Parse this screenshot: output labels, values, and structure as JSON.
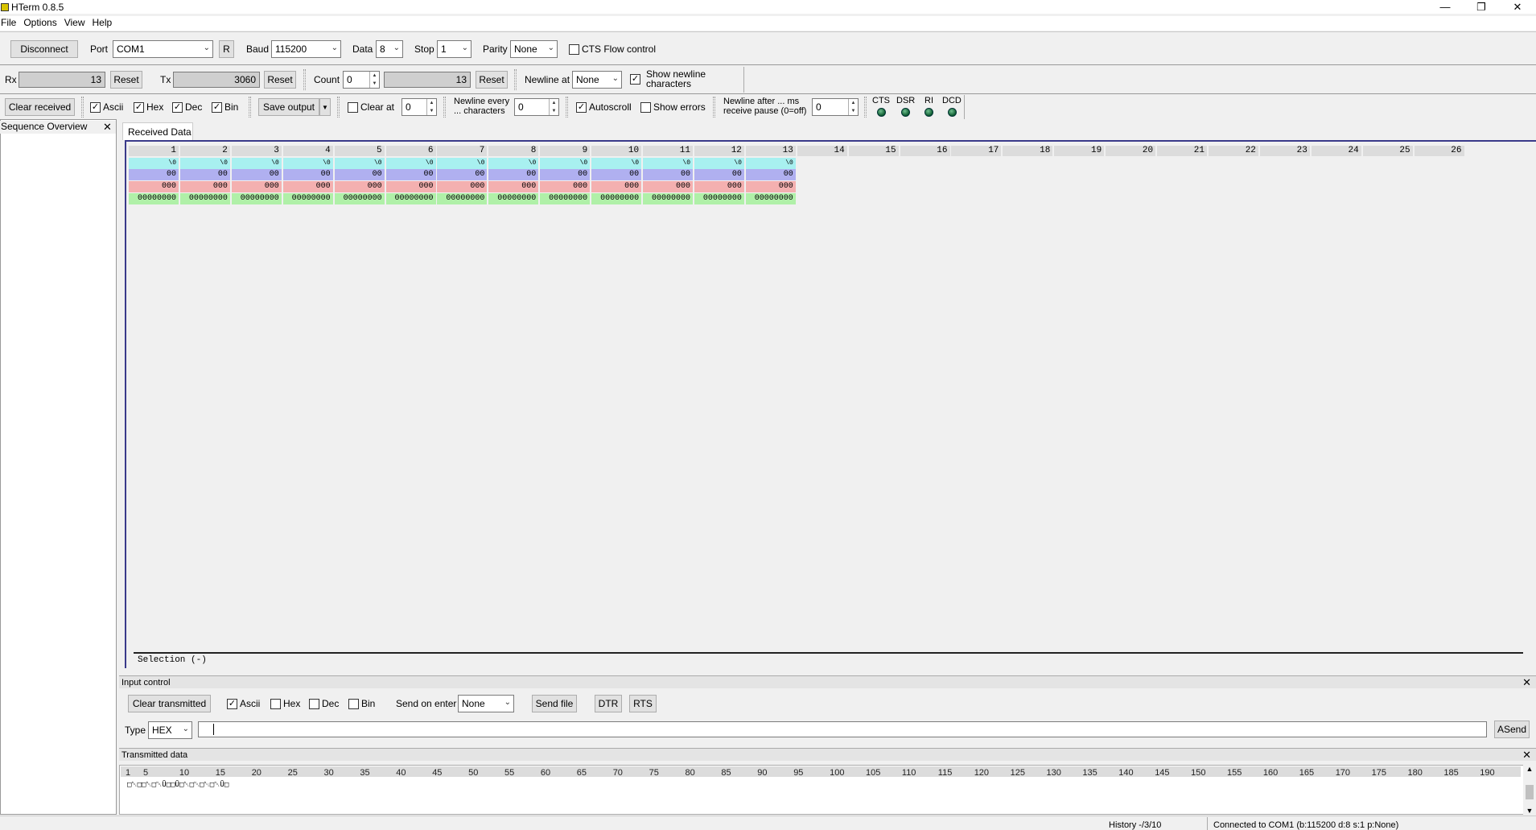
{
  "window": {
    "title": "HTerm 0.8.5",
    "minimize": "—",
    "restore": "❐",
    "close": "✕"
  },
  "menu": [
    "File",
    "Options",
    "View",
    "Help"
  ],
  "conn": {
    "disconnect": "Disconnect",
    "port_label": "Port",
    "port": "COM1",
    "r_button": "R",
    "baud_label": "Baud",
    "baud": "115200",
    "data_label": "Data",
    "data": "8",
    "stop_label": "Stop",
    "stop": "1",
    "parity_label": "Parity",
    "parity": "None",
    "cts_flow": "CTS Flow control"
  },
  "counters": {
    "rx_label": "Rx",
    "rx": "13",
    "rx_reset": "Reset",
    "tx_label": "Tx",
    "tx": "3060",
    "tx_reset": "Reset",
    "count_label": "Count",
    "count": "0",
    "count_value": "13",
    "count_reset": "Reset",
    "newline_label": "Newline at",
    "newline": "None",
    "show_newline": "Show newline characters"
  },
  "display": {
    "clear_received": "Clear received",
    "ascii": "Ascii",
    "hex": "Hex",
    "dec": "Dec",
    "bin": "Bin",
    "save_output": "Save output",
    "clear_at": "Clear at",
    "clear_at_value": "0",
    "newline_every": "Newline every ... characters",
    "newline_every_value": "0",
    "autoscroll": "Autoscroll",
    "show_errors": "Show errors",
    "newline_after": "Newline after ... ms receive pause (0=off)",
    "newline_after_value": "0",
    "signals": [
      "CTS",
      "DSR",
      "RI",
      "DCD"
    ]
  },
  "sequence_overview": {
    "title": "Sequence Overview",
    "close": "✕"
  },
  "received": {
    "tab": "Received Data",
    "columns": [
      "1",
      "2",
      "3",
      "4",
      "5",
      "6",
      "7",
      "8",
      "9",
      "10",
      "11",
      "12",
      "13",
      "14",
      "15",
      "16",
      "17",
      "18",
      "19",
      "20",
      "21",
      "22",
      "23",
      "24",
      "25",
      "26"
    ],
    "filled": 13,
    "ascii_row": "\\0",
    "hex_row": "00",
    "dec_row": "000",
    "bin_row": "00000000",
    "selection": "Selection (-)"
  },
  "input_control": {
    "title": "Input control",
    "close": "✕",
    "clear_transmitted": "Clear transmitted",
    "ascii": "Ascii",
    "hex": "Hex",
    "dec": "Dec",
    "bin": "Bin",
    "send_on_enter_label": "Send on enter",
    "send_on_enter": "None",
    "send_file": "Send file",
    "dtr": "DTR",
    "rts": "RTS",
    "type_label": "Type",
    "type": "HEX",
    "input_value": "",
    "asend": "ASend"
  },
  "transmitted": {
    "title": "Transmitted data",
    "close": "✕",
    "scale": [
      "1",
      "5",
      "10",
      "15",
      "20",
      "25",
      "30",
      "35",
      "40",
      "45",
      "50",
      "55",
      "60",
      "65",
      "70",
      "75",
      "80",
      "85",
      "90",
      "95",
      "100",
      "105",
      "110",
      "115",
      "120",
      "125",
      "130",
      "135",
      "140",
      "145",
      "150",
      "155",
      "160",
      "165",
      "170",
      "175",
      "180",
      "185",
      "190"
    ],
    "content": "□␀□□␀□␀Ū□□Ū□␀□␀□␀□␀Ū□"
  },
  "status": {
    "history": "History -/3/10",
    "connection": "Connected to COM1 (b:115200 d:8 s:1 p:None)"
  }
}
